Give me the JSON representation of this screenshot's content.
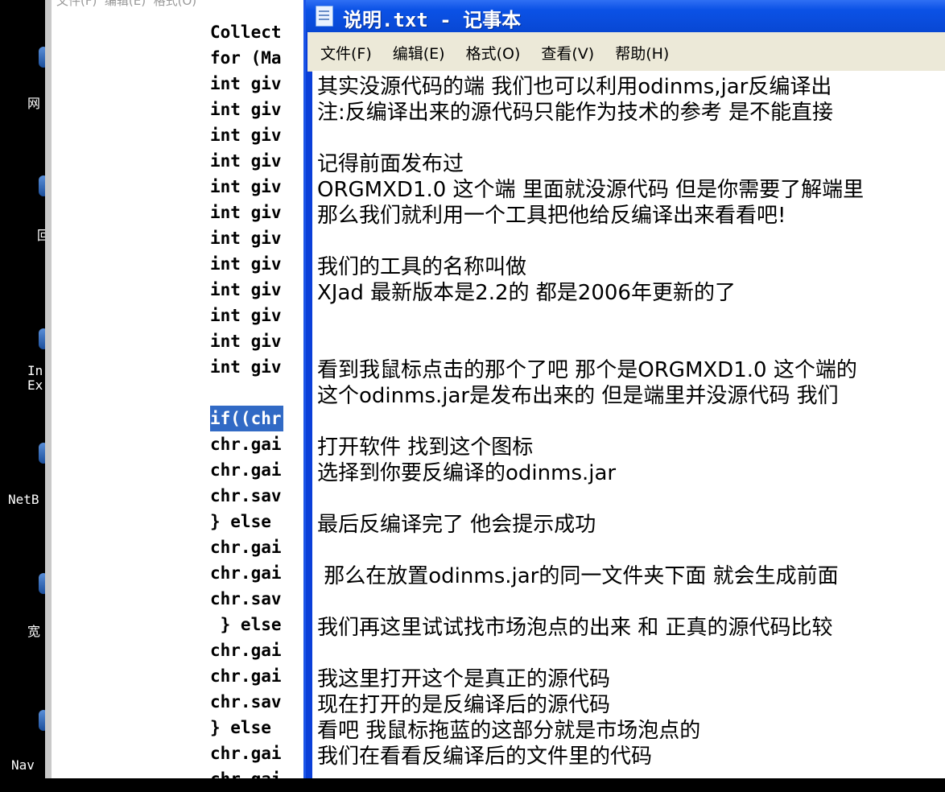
{
  "desktop": {
    "icons": [
      {
        "label": "网"
      },
      {
        "label": "回"
      },
      {
        "label": "In\nEx"
      },
      {
        "label": "NetB"
      },
      {
        "label": "宽"
      },
      {
        "label": "Nav"
      }
    ]
  },
  "background_editor": {
    "menu_ghost": "文件(F)  编辑(E)  格式(O)",
    "code_lines": [
      "Collect",
      "for (Ma",
      "int giv",
      "int giv",
      "int giv",
      "int giv",
      "int giv",
      "int giv",
      "int giv",
      "int giv",
      "int giv",
      "int giv",
      "int giv",
      "int giv",
      "",
      "if((chr",
      "chr.gai",
      "chr.gai",
      "chr.sav",
      "} else ",
      "chr.gai",
      "chr.gai",
      "chr.sav",
      " } else",
      "chr.gai",
      "chr.gai",
      "chr.sav",
      "} else ",
      "chr.gai",
      "chr.gai"
    ],
    "highlighted_line_index": 15
  },
  "notepad": {
    "title": "说明.txt - 记事本",
    "menu": [
      "文件(F)",
      "编辑(E)",
      "格式(O)",
      "查看(V)",
      "帮助(H)"
    ],
    "lines": [
      "其实没源代码的端 我们也可以利用odinms,jar反编译出",
      "注:反编译出来的源代码只能作为技术的参考 是不能直接",
      "",
      "记得前面发布过",
      "ORGMXD1.0 这个端 里面就没源代码 但是你需要了解端里",
      "那么我们就利用一个工具把他给反编译出来看看吧!",
      "",
      "我们的工具的名称叫做",
      "XJad 最新版本是2.2的 都是2006年更新的了",
      "",
      "",
      "看到我鼠标点击的那个了吧 那个是ORGMXD1.0 这个端的",
      "这个odinms.jar是发布出来的 但是端里并没源代码 我们",
      "",
      "打开软件 找到这个图标",
      "选择到你要反编译的odinms.jar",
      "",
      "最后反编译完了 他会提示成功",
      "",
      " 那么在放置odinms.jar的同一文件夹下面 就会生成前面",
      "",
      "我们再这里试试找市场泡点的出来 和 正真的源代码比较",
      "",
      "我这里打开这个是真正的源代码",
      "现在打开的是反编译后的源代码",
      "看吧 我鼠标拖蓝的这部分就是市场泡点的",
      "我们在看看反编译后的文件里的代码"
    ]
  },
  "colors": {
    "titlebar": "#0847d3",
    "selection": "#316ac5",
    "menubar": "#ece9d8"
  }
}
